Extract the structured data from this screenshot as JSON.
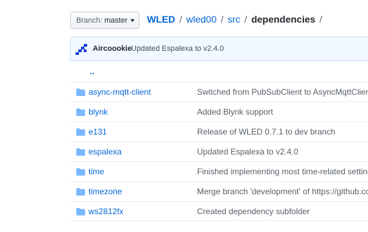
{
  "branch": {
    "prefix": "Branch:",
    "name": "master"
  },
  "breadcrumb": {
    "repo": "WLED",
    "path": [
      "wled00",
      "src"
    ],
    "current": "dependencies",
    "trailing_separator": "/"
  },
  "latest_commit": {
    "avatar_icon": "identicon-avatar",
    "author": "Aircoookie",
    "message": "Updated Espalexa to v2.4.0"
  },
  "files": {
    "parent_link": "..",
    "rows": [
      {
        "name": "async-mqtt-client",
        "commit": "Switched from PubSubClient to AsyncMqttClient"
      },
      {
        "name": "blynk",
        "commit": "Added Blynk support"
      },
      {
        "name": "e131",
        "commit": "Release of WLED 0.7.1 to dev branch"
      },
      {
        "name": "espalexa",
        "commit": "Updated Espalexa to v2.4.0"
      },
      {
        "name": "time",
        "commit": "Finished implementing most time-related settings"
      },
      {
        "name": "timezone",
        "commit": "Merge branch 'development' of https://github.com"
      },
      {
        "name": "ws2812fx",
        "commit": "Created dependency subfolder"
      }
    ]
  },
  "colors": {
    "link": "#0366d6",
    "folder": "#79b8ff",
    "commit_bar_bg": "#f1f8ff"
  }
}
